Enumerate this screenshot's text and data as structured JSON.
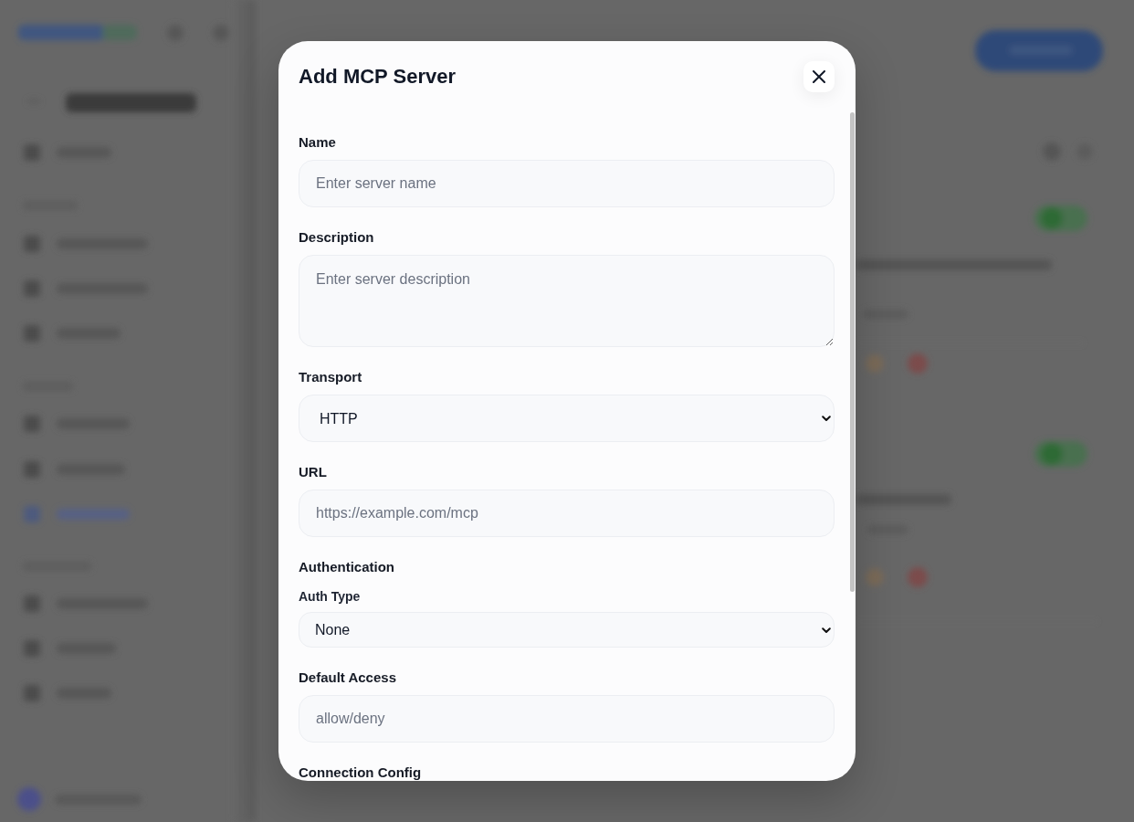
{
  "dialog": {
    "title": "Add MCP Server",
    "fields": [
      {
        "kind": "input",
        "label": "Name",
        "placeholder": "Enter server name"
      },
      {
        "kind": "textarea",
        "label": "Description",
        "placeholder": "Enter server description"
      },
      {
        "kind": "select",
        "label": "Transport",
        "value": "HTTP"
      },
      {
        "kind": "input",
        "label": "URL",
        "placeholder": "https://example.com/mcp"
      },
      {
        "kind": "section",
        "label": "Authentication",
        "fields": [
          {
            "kind": "select",
            "label": "Auth Type",
            "value": "None"
          }
        ]
      },
      {
        "kind": "input",
        "label": "Default Access",
        "placeholder": "allow/deny"
      },
      {
        "kind": "heading",
        "label": "Connection Config"
      }
    ]
  }
}
